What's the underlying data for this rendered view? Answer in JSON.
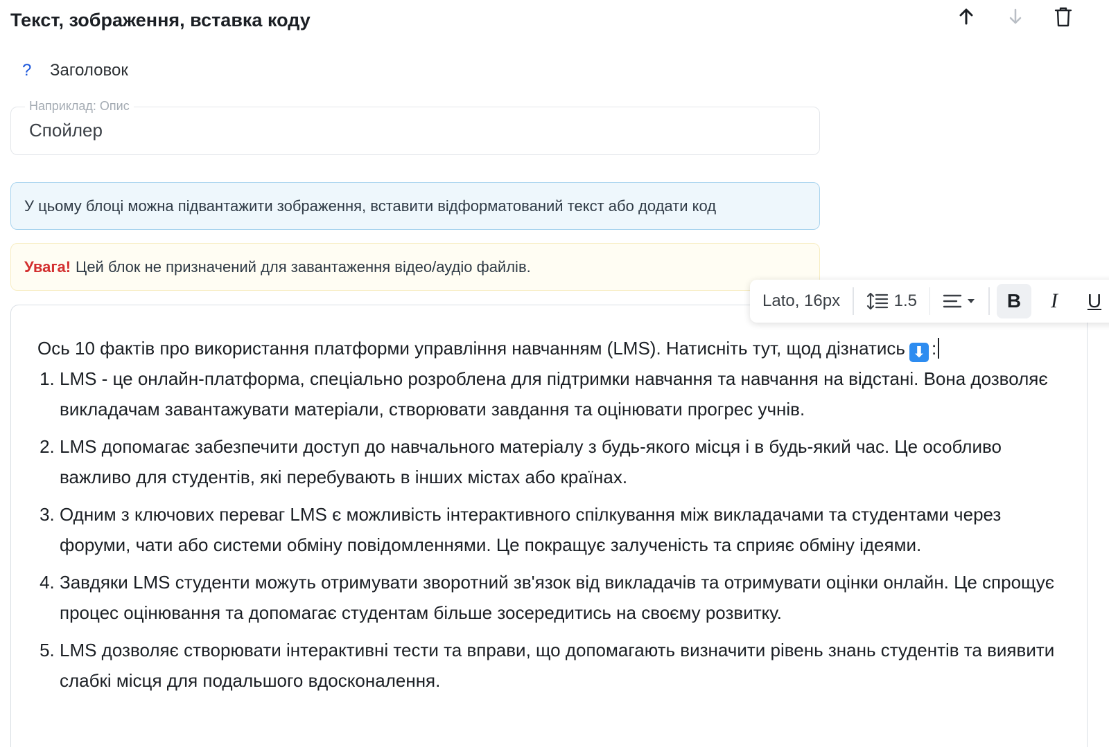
{
  "block": {
    "title": "Текст, зображення, вставка коду",
    "icons": {
      "move_up": "arrow-up-icon",
      "move_down": "arrow-down-icon",
      "delete": "trash-icon"
    }
  },
  "heading": {
    "help": "?",
    "label": "Заголовок"
  },
  "title_field": {
    "legend": "Наприклад: Опис",
    "value": "Спойлер"
  },
  "info": {
    "text": "У цьому блоці можна підвантажити зображення, вставити відформатований текст або додати код"
  },
  "warning": {
    "strong": "Увага!",
    "text": "Цей блок не призначений для завантаження відео/аудіо файлів."
  },
  "toolbar": {
    "font": "Lato, 16px",
    "line_height": "1.5",
    "bold": "B",
    "italic": "I",
    "underline": "U"
  },
  "editor": {
    "intro": "Ось 10 фактів про використання платформи управління навчанням (LMS). Натисніть тут, щод дізнатись",
    "intro_emoji": "⬇",
    "intro_tail": ":",
    "items": [
      "LMS - це онлайн-платформа, спеціально розроблена для підтримки навчання та навчання на відстані. Вона дозволяє викладачам завантажувати матеріали, створювати завдання та оцінювати прогрес учнів.",
      "LMS допомагає забезпечити доступ до навчального матеріалу з будь-якого місця і в будь-який час. Це особливо важливо для студентів, які перебувають в інших містах або країнах.",
      "Одним з ключових переваг LMS є можливість інтерактивного спілкування між викладачами та студентами через форуми, чати або системи обміну повідомленнями. Це покращує залученість та сприяє обміну ідеями.",
      "Завдяки LMS студенти можуть отримувати зворотний зв'язок від викладачів та отримувати оцінки онлайн. Це спрощує процес оцінювання та допомагає студентам більше зосередитись на своєму розвитку.",
      "LMS дозволяє створювати інтерактивні тести та вправи, що допомагають визначити рівень знань студентів та виявити слабкі місця для подальшого вдосконалення."
    ]
  }
}
